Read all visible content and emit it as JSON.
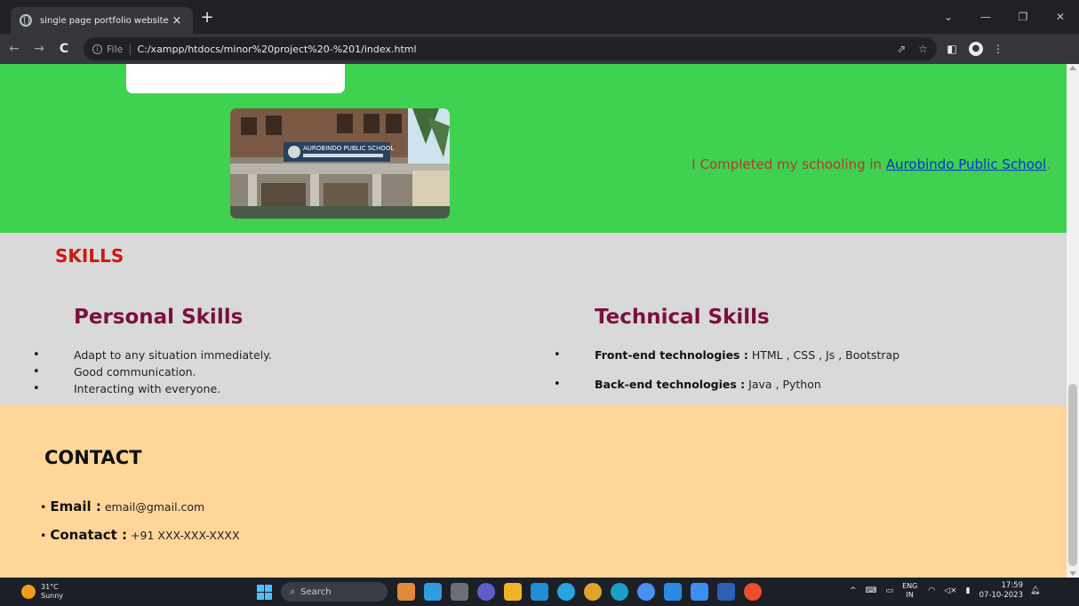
{
  "browser": {
    "tab_title": "single page portfolio website",
    "tab_close": "×",
    "new_tab": "+",
    "url_label": "File",
    "url_separator": "|",
    "url": "C:/xampp/htdocs/minor%20project%20-%201/index.html"
  },
  "education": {
    "text_prefix": "I Completed my schooling in ",
    "school_link": "Aurobindo Public School",
    "text_suffix": ".",
    "photo_sign": "AUROBINDO PUBLIC SCHOOL"
  },
  "skills": {
    "heading": "SKILLS",
    "personal": {
      "title": "Personal Skills",
      "items": [
        "Adapt to any situation immediately.",
        "Good communication.",
        "Interacting with everyone."
      ]
    },
    "technical": {
      "title": "Technical Skills",
      "items": [
        {
          "label": "Front-end technologies :",
          "value": " HTML , CSS , Js , Bootstrap"
        },
        {
          "label": "Back-end technologies :",
          "value": " Java , Python"
        }
      ]
    }
  },
  "contact": {
    "heading": "CONTACT",
    "items": [
      {
        "label": "Email :",
        "value": " email@gmail.com"
      },
      {
        "label": "Conatact :",
        "value": " +91 XXX-XXX-XXXX"
      }
    ]
  },
  "taskbar": {
    "temperature": "31°C",
    "condition": "Sunny",
    "search_placeholder": "Search",
    "lang_top": "ENG",
    "lang_bottom": "IN",
    "time": "17:59",
    "date": "07-10-2023"
  },
  "colors": {
    "education_bg": "#3fd150",
    "skills_bg": "#d9d9d9",
    "contact_bg": "#ffd59a",
    "skills_heading": "#cc1a10",
    "skill_titles": "#7a1140",
    "link": "#0b33cc"
  }
}
